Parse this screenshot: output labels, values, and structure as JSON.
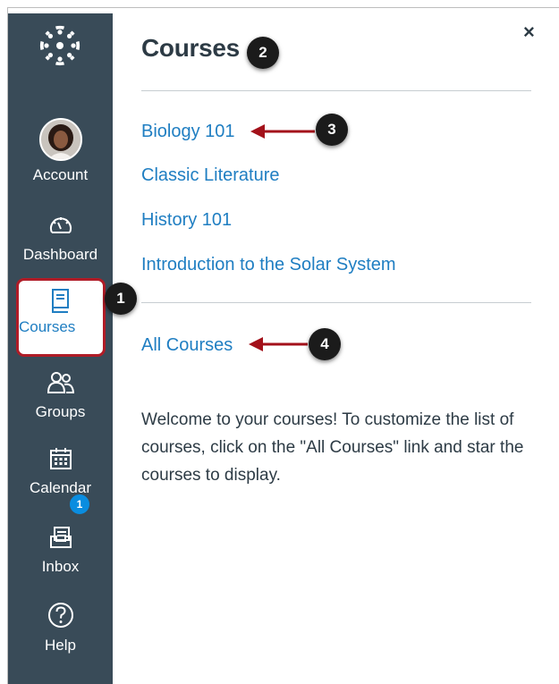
{
  "nav": {
    "account": "Account",
    "dashboard": "Dashboard",
    "courses": "Courses",
    "groups": "Groups",
    "calendar": "Calendar",
    "inbox": "Inbox",
    "inbox_badge": "1",
    "help": "Help"
  },
  "tray": {
    "title": "Courses",
    "close_label": "×",
    "courses": [
      "Biology 101",
      "Classic Literature",
      "History 101",
      "Introduction to the Solar System"
    ],
    "all_courses": "All Courses",
    "welcome_text": "Welcome to your courses! To customize the list of courses, click on the \"All Courses\" link and star the courses to display."
  },
  "callouts": [
    "1",
    "2",
    "3",
    "4"
  ],
  "colors": {
    "sidebar": "#394b58",
    "link": "#1f7ec2",
    "highlight_border": "#b01c27",
    "arrow": "#a3111a",
    "badge": "#0a8de0",
    "callout_bg": "#1b1b1b"
  }
}
